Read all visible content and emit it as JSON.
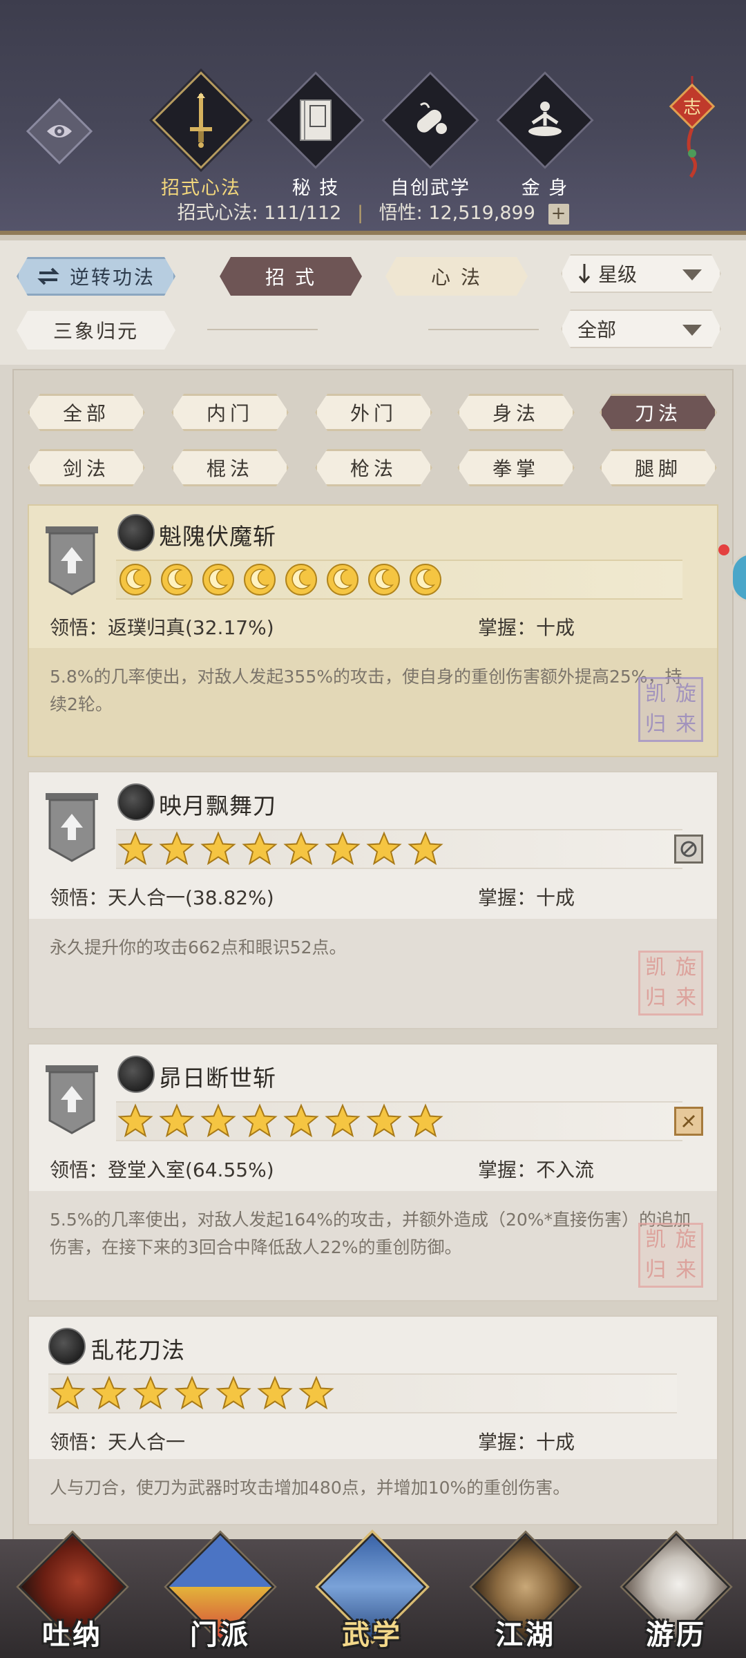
{
  "header": {
    "tabs": [
      {
        "label": "招式心法",
        "icon": "sword-icon",
        "active": true
      },
      {
        "label": "秘 技",
        "icon": "book-icon",
        "active": false
      },
      {
        "label": "自创武学",
        "icon": "scroll-icon",
        "active": false
      },
      {
        "label": "金 身",
        "icon": "meditation-icon",
        "active": false
      }
    ],
    "stats": {
      "moves_label": "招式心法: 111/112",
      "insight_label": "悟性: 12,519,899",
      "plus": "+"
    },
    "charm_text": "志"
  },
  "controls": {
    "reverse_btn": "逆转功法",
    "moves_tab": "招 式",
    "mind_tab": "心 法",
    "sort_dropdown": "星级",
    "sanxiang_btn": "三象归元",
    "filter_dropdown": "全部"
  },
  "filters": [
    {
      "label": "全部",
      "active": false
    },
    {
      "label": "内门",
      "active": false
    },
    {
      "label": "外门",
      "active": false
    },
    {
      "label": "身法",
      "active": false
    },
    {
      "label": "刀法",
      "active": true
    },
    {
      "label": "剑法",
      "active": false
    },
    {
      "label": "棍法",
      "active": false
    },
    {
      "label": "枪法",
      "active": false
    },
    {
      "label": "拳掌",
      "active": false
    },
    {
      "label": "腿脚",
      "active": false
    }
  ],
  "skills": [
    {
      "name": "魁隗伏魔斩",
      "rating_type": "moon",
      "rating_count": 8,
      "insight": "领悟：返璞归真(32.17%)",
      "mastery": "掌握：十成",
      "description": "5.8%的几率使出，对敌人发起355%的攻击，使自身的重创伤害额外提高25%，持续2轮。",
      "seal": [
        "凯",
        "旋",
        "归",
        "来"
      ]
    },
    {
      "name": "映月飘舞刀",
      "rating_type": "star",
      "rating_count": 8,
      "insight": "领悟：天人合一(38.82%)",
      "mastery": "掌握：十成",
      "description": "永久提升你的攻击662点和眼识52点。",
      "seal": [
        "凯",
        "旋",
        "归",
        "来"
      ]
    },
    {
      "name": "昴日断世斩",
      "rating_type": "star",
      "rating_count": 8,
      "insight": "领悟：登堂入室(64.55%)",
      "mastery": "掌握：不入流",
      "description": "5.5%的几率使出，对敌人发起164%的攻击，并额外造成（20%*直接伤害）的追加伤害，在接下来的3回合中降低敌人22%的重创防御。",
      "seal": [
        "凯",
        "旋",
        "归",
        "来"
      ]
    },
    {
      "name": "乱花刀法",
      "rating_type": "star",
      "rating_count": 7,
      "insight": "领悟：天人合一",
      "mastery": "掌握：十成",
      "description": "人与刀合，使刀为武器时攻击增加480点，并增加10%的重创伤害。"
    }
  ],
  "bottom_nav": [
    {
      "label": "吐纳",
      "active": false
    },
    {
      "label": "门派",
      "active": false
    },
    {
      "label": "武学",
      "active": true
    },
    {
      "label": "江湖",
      "active": false
    },
    {
      "label": "游历",
      "active": false
    }
  ],
  "colors": {
    "header_bg": "#474759",
    "active_tab": "#6e5555",
    "gold_text": "#f2d77c",
    "star": "#f5c542"
  }
}
